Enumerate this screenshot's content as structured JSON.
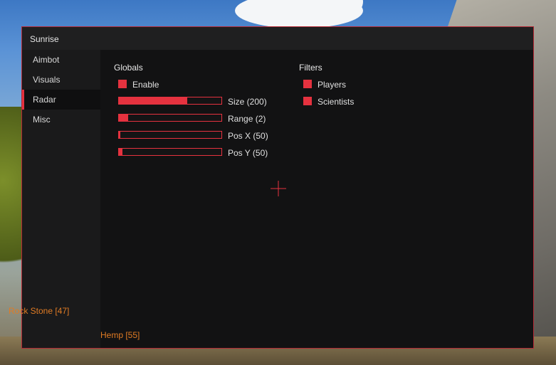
{
  "app": {
    "title": "Sunrise"
  },
  "nav": [
    {
      "label": "Aimbot",
      "active": false
    },
    {
      "label": "Visuals",
      "active": false
    },
    {
      "label": "Radar",
      "active": true
    },
    {
      "label": "Misc",
      "active": false
    }
  ],
  "globals": {
    "title": "Globals",
    "enable": {
      "label": "Enable",
      "checked": true
    },
    "sliders": [
      {
        "label": "Size (200)",
        "fill_fraction": 0.67
      },
      {
        "label": "Range (2)",
        "fill_fraction": 0.09
      },
      {
        "label": "Pos X (50)",
        "fill_fraction": 0.015
      },
      {
        "label": "Pos Y (50)",
        "fill_fraction": 0.035
      }
    ]
  },
  "filters": {
    "title": "Filters",
    "items": [
      {
        "label": "Players",
        "checked": true
      },
      {
        "label": "Scientists",
        "checked": true
      }
    ]
  },
  "overlay": {
    "rock_label": "Rock Stone [47]",
    "hemp_label": "Hemp [55]"
  },
  "colors": {
    "accent": "#e5323f",
    "esp_text": "#e07b24"
  }
}
